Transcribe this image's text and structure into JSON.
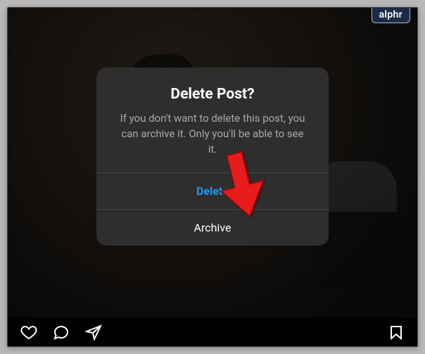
{
  "badge": {
    "label": "alphr"
  },
  "dialog": {
    "title": "Delete Post?",
    "body": "If you don't want to delete this post, you can archive it. Only you'll be able to see it.",
    "delete_label": "Delete",
    "archive_label": "Archive"
  },
  "actions": {
    "like": "heart-icon",
    "comment": "comment-icon",
    "share": "share-icon",
    "save": "bookmark-icon"
  }
}
